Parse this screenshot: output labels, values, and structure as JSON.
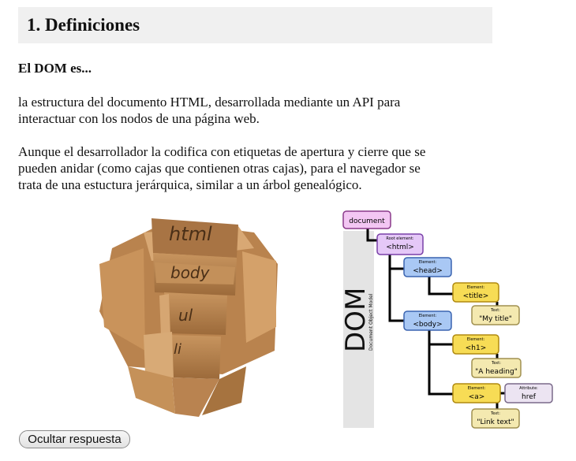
{
  "section": {
    "title": "1. Definiciones"
  },
  "subtitle": "El DOM es...",
  "paragraphs": {
    "p1_l1": "la estructura del documento HTML, desarrollada mediante un API para",
    "p1_l2": "interactuar con los nodos de una página web.",
    "p2_l1": "Aunque el desarrollador la codifica con etiquetas de apertura y cierre que se",
    "p2_l2": "pueden anidar (como cajas que contienen otras cajas), para el navegador se",
    "p2_l3": "trata de una estuctura jerárquica, similar a un árbol genealógico."
  },
  "boxes_image": {
    "labels": [
      "html",
      "body",
      "ul",
      "li"
    ]
  },
  "dom_diagram": {
    "side_title": "DOM",
    "side_subtitle": "Document Object Model",
    "document": "document",
    "root_caption": "Root element:",
    "root": "<html>",
    "head_caption": "Element:",
    "head": "<head>",
    "body_caption": "Element:",
    "body": "<body>",
    "title_caption": "Element:",
    "title": "<title>",
    "title_text_caption": "Text:",
    "title_text": "\"My title\"",
    "h1_caption": "Element:",
    "h1": "<h1>",
    "h1_text_caption": "Text:",
    "h1_text": "\"A heading\"",
    "a_caption": "Element:",
    "a": "<a>",
    "attr_caption": "Attribute:",
    "attr": "href",
    "a_text_caption": "Text:",
    "a_text": "\"Link text\""
  },
  "button": {
    "label": "Ocultar respuesta"
  }
}
